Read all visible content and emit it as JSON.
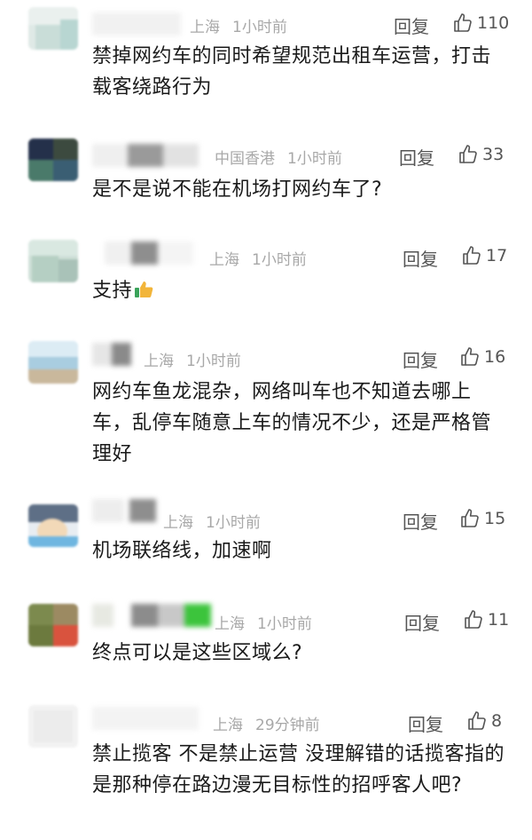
{
  "comments": [
    {
      "location": "上海",
      "time": "1小时前",
      "reply_label": "回复",
      "likes": "110",
      "text": "禁掉网约车的同时希望规范出租车运营，打击载客绕路行为"
    },
    {
      "location": "中国香港",
      "time": "1小时前",
      "reply_label": "回复",
      "likes": "33",
      "text": "是不是说不能在机场打网约车了?"
    },
    {
      "location": "上海",
      "time": "1小时前",
      "reply_label": "回复",
      "likes": "17",
      "text": "支持"
    },
    {
      "location": "上海",
      "time": "1小时前",
      "reply_label": "回复",
      "likes": "16",
      "text": "网约车鱼龙混杂，网络叫车也不知道去哪上车，乱停车随意上车的情况不少，还是严格管理好"
    },
    {
      "location": "上海",
      "time": "1小时前",
      "reply_label": "回复",
      "likes": "15",
      "text": "机场联络线，加速啊"
    },
    {
      "location": "上海",
      "time": "1小时前",
      "reply_label": "回复",
      "likes": "11",
      "text": "终点可以是这些区域么?"
    },
    {
      "location": "上海",
      "time": "29分钟前",
      "reply_label": "回复",
      "likes": "8",
      "text": "禁止揽客 不是禁止运营 没理解错的话揽客指的是那种停在路边漫无目标性的招呼客人吧?"
    }
  ],
  "icons": {
    "like": "thumbs-up-outline-icon",
    "emoji": "thumbs-up-emoji"
  }
}
